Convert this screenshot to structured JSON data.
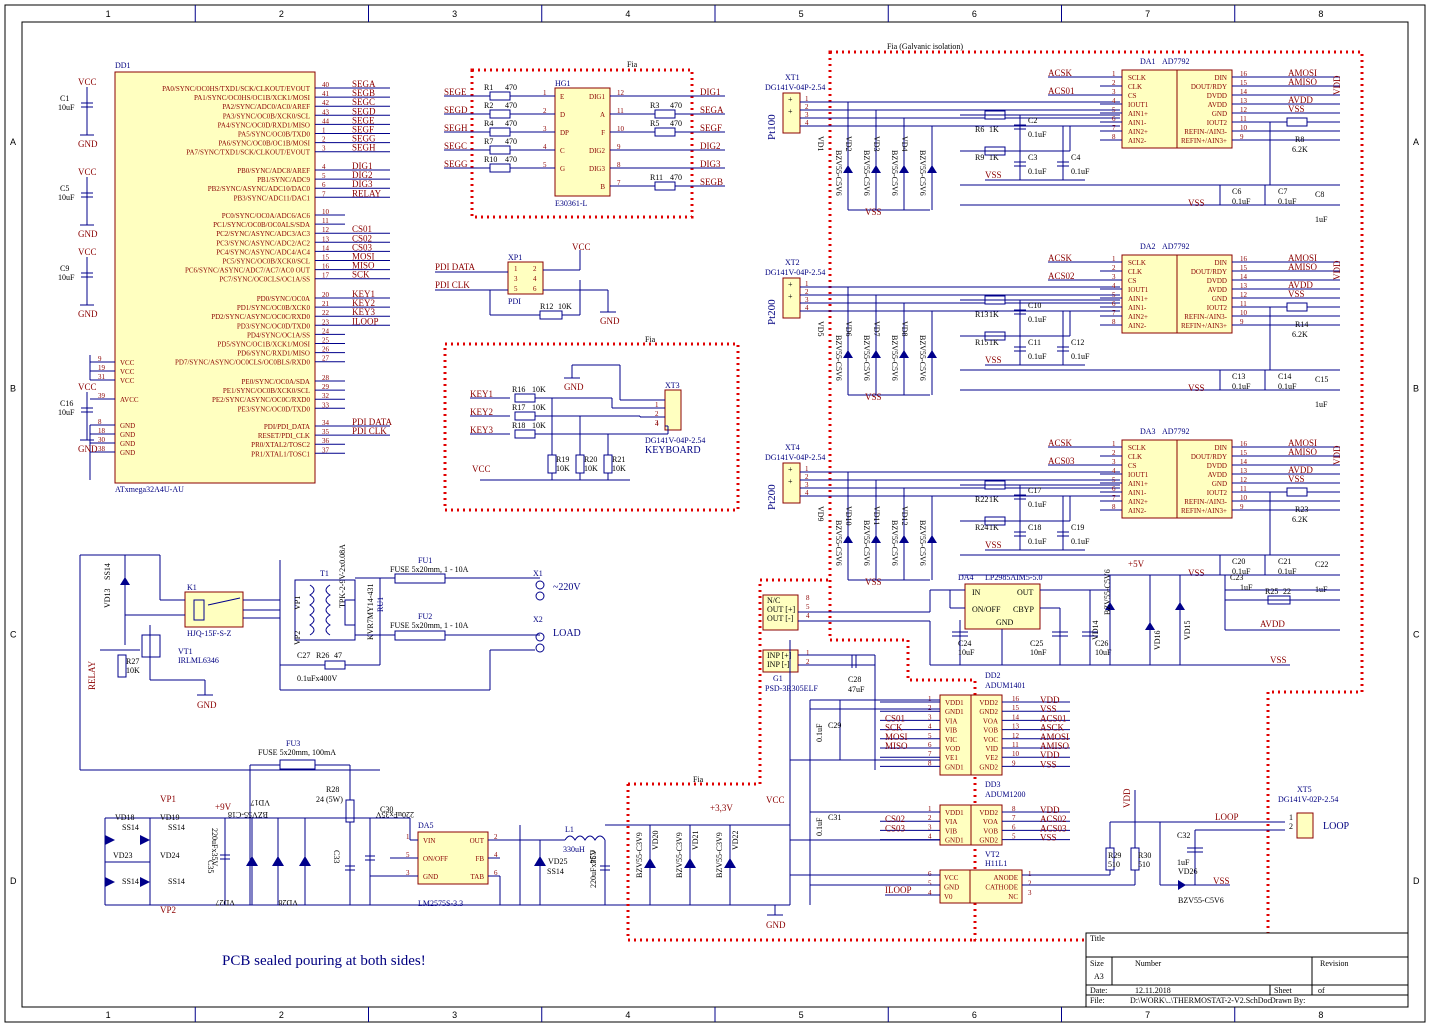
{
  "grid": {
    "cols": [
      "1",
      "2",
      "3",
      "4",
      "5",
      "6",
      "7",
      "8"
    ],
    "rows": [
      "A",
      "B",
      "C",
      "D"
    ]
  },
  "mcu": {
    "ref": "DD1",
    "part": "ATxmega32A4U-AU",
    "left_pins": [
      {
        "num": "9",
        "name": "VCC"
      },
      {
        "num": "19",
        "name": "VCC"
      },
      {
        "num": "31",
        "name": "VCC"
      },
      {
        "num": "39",
        "name": "AVCC"
      },
      {
        "num": "8",
        "name": "GND"
      },
      {
        "num": "18",
        "name": "GND"
      },
      {
        "num": "30",
        "name": "GND"
      },
      {
        "num": "38",
        "name": "GND"
      }
    ],
    "port_a": [
      {
        "name": "PA0/SYNC/OC0HS/TXD1/SCK/CLKOUT/EVOUT",
        "pin": "40",
        "net": "SEGA"
      },
      {
        "name": "PA1/SYNC/OC0HS/OC1B/XCK1/MOSI",
        "pin": "41",
        "net": "SEGB"
      },
      {
        "name": "PA2/SYNC/ADC0/AC0/AREF",
        "pin": "42",
        "net": "SEGC"
      },
      {
        "name": "PA3/SYNC/OC0B/XCK0/SCL",
        "pin": "43",
        "net": "SEGD"
      },
      {
        "name": "PA4/SYNC/OC0D/RXD1/MISO",
        "pin": "44",
        "net": "SEGE"
      },
      {
        "name": "PA5/SYNC/OC0B/TXD0",
        "pin": "1",
        "net": "SEGF"
      },
      {
        "name": "PA6/SYNC/OC0B/OC1B/MOSI",
        "pin": "2",
        "net": "SEGG"
      },
      {
        "name": "PA7/SYNC/TXD1/SCK/CLKOUT/EVOUT",
        "pin": "3",
        "net": "SEGH"
      }
    ],
    "port_b": [
      {
        "name": "PB0/SYNC/ADC8/AREF",
        "pin": "4",
        "net": "DIG1"
      },
      {
        "name": "PB1/SYNC/ADC9",
        "pin": "5",
        "net": "DIG2"
      },
      {
        "name": "PB2/SYNC/ASYNC/ADC10/DAC0",
        "pin": "6",
        "net": "DIG3"
      },
      {
        "name": "PB3/SYNC/ADC11/DAC1",
        "pin": "7",
        "net": "RELAY"
      }
    ],
    "port_c": [
      {
        "name": "PC0/SYNC/OC0A/ADC6/AC6",
        "pin": "10",
        "net": ""
      },
      {
        "name": "PC1/SYNC/OC0B/OC0ALS/SDA",
        "pin": "11",
        "net": ""
      },
      {
        "name": "PC2/SYNC/ASYNC/ADC3/AC3",
        "pin": "12",
        "net": "CS01"
      },
      {
        "name": "PC3/SYNC/ASYNC/ADC2/AC2",
        "pin": "13",
        "net": "CS02"
      },
      {
        "name": "PC4/SYNC/ASYNC/ADC4/AC4",
        "pin": "14",
        "net": "CS03"
      },
      {
        "name": "PC5/SYNC/OC0B/XCK0/SCL",
        "pin": "15",
        "net": "MOSI"
      },
      {
        "name": "PC6/SYNC/ASYNC/ADC7/AC7/AC0 OUT",
        "pin": "16",
        "net": "MISO"
      },
      {
        "name": "PC7/SYNC/OC0CLS/OC1A/SS",
        "pin": "17",
        "net": "SCK"
      }
    ],
    "port_d": [
      {
        "name": "PD0/SYNC/OC0A",
        "pin": "20",
        "net": "KEY1"
      },
      {
        "name": "PD1/SYNC/OC0B/XCK0",
        "pin": "21",
        "net": "KEY2"
      },
      {
        "name": "PD2/SYNC/ASYNC/OC0C/RXD0",
        "pin": "22",
        "net": "KEY3"
      },
      {
        "name": "PD3/SYNC/OC0D/TXD0",
        "pin": "23",
        "net": "ILOOP"
      },
      {
        "name": "PD4/SYNC/OC1A/SS",
        "pin": "24",
        "net": ""
      },
      {
        "name": "PD5/SYNC/OC1B/XCK1/MOSI",
        "pin": "25",
        "net": ""
      },
      {
        "name": "PD6/SYNC/RXD1/MISO",
        "pin": "26",
        "net": ""
      },
      {
        "name": "PD7/SYNC/ASYNC/OC0CLS/OC0BLS/RXD0",
        "pin": "27",
        "net": ""
      }
    ],
    "port_e": [
      {
        "name": "PE0/SYNC/OC0A/SDA",
        "pin": "28",
        "net": ""
      },
      {
        "name": "PE1/SYNC/OC0B/XCK0/SCL",
        "pin": "29",
        "net": ""
      },
      {
        "name": "PE2/SYNC/ASYNC/OC0C/RXD0",
        "pin": "32",
        "net": ""
      },
      {
        "name": "PE3/SYNC/OC0D/TXD0",
        "pin": "33",
        "net": ""
      }
    ],
    "port_misc": [
      {
        "name": "PDI/PDI_DATA",
        "pin": "34",
        "net": "PDI DATA"
      },
      {
        "name": "RESET/PDI_CLK",
        "pin": "35",
        "net": "PDI CLK"
      },
      {
        "name": "PR0/XTAL2/TOSC2",
        "pin": "36",
        "net": ""
      },
      {
        "name": "PR1/XTAL1/TOSC1",
        "pin": "37",
        "net": ""
      }
    ]
  },
  "decoupling": [
    {
      "ref": "C1",
      "value": "10uF",
      "vcc": "VCC",
      "gnd": "GND"
    },
    {
      "ref": "C5",
      "value": "10uF",
      "vcc": "VCC",
      "gnd": "GND"
    },
    {
      "ref": "C9",
      "value": "10uF",
      "vcc": "VCC",
      "gnd": "GND"
    },
    {
      "ref": "C16",
      "value": "10uF",
      "vcc": "VCC",
      "gnd": "GND"
    }
  ],
  "display": {
    "box_title": "Fia",
    "ref": "HG1",
    "part": "E30361-L",
    "left_pins": [
      {
        "net": "SEGE",
        "res": "R1",
        "val": "470",
        "pin": "1",
        "name": "E"
      },
      {
        "net": "SEGD",
        "res": "R2",
        "val": "470",
        "pin": "2",
        "name": "D"
      },
      {
        "net": "SEGH",
        "res": "R4",
        "val": "470",
        "pin": "3",
        "name": "DP"
      },
      {
        "net": "SEGC",
        "res": "R7",
        "val": "470",
        "pin": "4",
        "name": "C"
      },
      {
        "net": "SEGG",
        "res": "R10",
        "val": "470",
        "pin": "5",
        "name": "G"
      }
    ],
    "right_pins": [
      {
        "net": "DIG1",
        "res": "",
        "val": "",
        "pin": "12",
        "name": "DIG1"
      },
      {
        "net": "SEGA",
        "res": "R3",
        "val": "470",
        "pin": "11",
        "name": "A"
      },
      {
        "net": "SEGF",
        "res": "R5",
        "val": "470",
        "pin": "10",
        "name": "F"
      },
      {
        "net": "DIG2",
        "res": "",
        "val": "",
        "pin": "9",
        "name": "DIG2"
      },
      {
        "net": "DIG3",
        "res": "",
        "val": "",
        "pin": "8",
        "name": "DIG3"
      },
      {
        "net": "SEGB",
        "res": "R11",
        "val": "470",
        "pin": "7",
        "name": "B"
      }
    ]
  },
  "pdi": {
    "ref": "XP1",
    "part": "PDI",
    "data": "PDI DATA",
    "clk": "PDI CLK",
    "pins": [
      "1",
      "2",
      "3",
      "4",
      "5",
      "6"
    ],
    "res": "R12",
    "res_val": "10K",
    "vcc": "VCC",
    "gnd": "GND"
  },
  "keyboard": {
    "box_title": "Fia",
    "ref": "XT3",
    "part": "DG141V-04P-2.54",
    "name": "KEYBOARD",
    "gnd": "GND",
    "vcc": "VCC",
    "keys": [
      {
        "net": "KEY1",
        "res": "R16",
        "val": "10K",
        "pull": "R19",
        "pull_val": "10K",
        "pin": "1"
      },
      {
        "net": "KEY2",
        "res": "R17",
        "val": "10K",
        "pull": "R20",
        "pull_val": "10K",
        "pin": "2"
      },
      {
        "net": "KEY3",
        "res": "R18",
        "val": "10K",
        "pull": "R21",
        "pull_val": "10K",
        "pin": "3"
      }
    ],
    "pin4": "4"
  },
  "isolation": {
    "title": "Fia (Galvanic isolation)",
    "channels": [
      {
        "conn": "XT1",
        "conn_part": "DG141V-04P-2.54",
        "sensor": "Pt100",
        "adc": "DA1",
        "adc_part": "AD7792",
        "diodes": [
          "VD1",
          "VD2",
          "VD3",
          "VD4"
        ],
        "res_a": "R6",
        "res_a_val": "1K",
        "res_b": "R9",
        "res_b_val": "1K",
        "caps": [
          "C2",
          "C3",
          "C4"
        ],
        "cap_val": "0.1uF",
        "cs": "ACS01",
        "rref": "R8",
        "rref_val": "6.2K",
        "c_a": "C6",
        "c_b": "C7",
        "c_c": "C8",
        "c_c_val": "1uF"
      },
      {
        "conn": "XT2",
        "conn_part": "DG141V-04P-2.54",
        "sensor": "Pt200",
        "adc": "DA2",
        "adc_part": "AD7792",
        "diodes": [
          "VD5",
          "VD6",
          "VD7",
          "VD8"
        ],
        "res_a": "R13",
        "res_a_val": "1K",
        "res_b": "R15",
        "res_b_val": "1K",
        "caps": [
          "C10",
          "C11",
          "C12"
        ],
        "cap_val": "0.1uF",
        "cs": "ACS02",
        "rref": "R14",
        "rref_val": "6.2K",
        "c_a": "C13",
        "c_b": "C14",
        "c_c": "C15",
        "c_c_val": "1uF"
      },
      {
        "conn": "XT4",
        "conn_part": "DG141V-04P-2.54",
        "sensor": "Pt200",
        "adc": "DA3",
        "adc_part": "AD7792",
        "diodes": [
          "VD9",
          "VD10",
          "VD11",
          "VD12"
        ],
        "res_a": "R22",
        "res_a_val": "1K",
        "res_b": "R24",
        "res_b_val": "1K",
        "caps": [
          "C17",
          "C18",
          "C19"
        ],
        "cap_val": "0.1uF",
        "cs": "ACS03",
        "rref": "R23",
        "rref_val": "6.2K",
        "c_a": "C20",
        "c_b": "C21",
        "c_c": "C22",
        "c_c_val": "1uF"
      }
    ],
    "diode_part": "BZV55-C5V6",
    "vss": "VSS",
    "adc_left": [
      {
        "name": "SCLK",
        "pin": "1"
      },
      {
        "name": "CLK",
        "pin": "2"
      },
      {
        "name": "CS",
        "pin": "3"
      },
      {
        "name": "IOUT1",
        "pin": "4"
      },
      {
        "name": "AIN1+",
        "pin": "5"
      },
      {
        "name": "AIN1-",
        "pin": "6"
      },
      {
        "name": "AIN2+",
        "pin": "7"
      },
      {
        "name": "AIN2-",
        "pin": "8"
      }
    ],
    "adc_right": [
      {
        "name": "DIN",
        "pin": "16",
        "net": "AMOSI"
      },
      {
        "name": "DOUT/RDY",
        "pin": "15",
        "net": "AMISO"
      },
      {
        "name": "DVDD",
        "pin": "14",
        "net": ""
      },
      {
        "name": "AVDD",
        "pin": "13",
        "net": "AVDD"
      },
      {
        "name": "GND",
        "pin": "12",
        "net": "VSS"
      },
      {
        "name": "IOUT2",
        "pin": "11",
        "net": ""
      },
      {
        "name": "REFIN-/AIN3-",
        "pin": "10",
        "net": ""
      },
      {
        "name": "REFIN+/AIN3+",
        "pin": "9",
        "net": ""
      }
    ],
    "ack": "ACSK",
    "vdd": "VDD"
  },
  "ldo": {
    "ref": "DA4",
    "part": "LP2985AIM5-5.0",
    "pins": [
      {
        "num": "1",
        "name": "IN"
      },
      {
        "num": "3",
        "name": "ON/OFF"
      },
      {
        "num": "2",
        "name": "GND"
      },
      {
        "num": "5",
        "name": "OUT"
      },
      {
        "num": "4",
        "name": "CBYP"
      }
    ],
    "c24": "C24",
    "c24_val": "10uF",
    "c25": "C25",
    "c25_val": "10nF",
    "c26": "C26",
    "c26_val": "10uF",
    "c23": "C23",
    "c23_val": "1uF",
    "r25": "R25",
    "r25_val": "22",
    "plus5": "+5V",
    "d14": "VD14",
    "d15": "VD15",
    "d16": "VD16",
    "d_part": "BZV55-C5V6",
    "avdd": "AVDD",
    "vss": "VSS"
  },
  "isolated_psu": {
    "ref": "G1",
    "part": "PSD-3R305ELF",
    "pins": [
      {
        "num": "8",
        "name": "N/C"
      },
      {
        "num": "5",
        "name": "OUT [+]"
      },
      {
        "num": "4",
        "name": "OUT [-]"
      },
      {
        "num": "1",
        "name": "INP [+]"
      },
      {
        "num": "2",
        "name": "INP [-]"
      }
    ],
    "c28": "C28",
    "c28_val": "47uF"
  },
  "adum1401": {
    "ref": "DD2",
    "part": "ADUM1401",
    "c29": "C29",
    "c29_val": "0.1uF",
    "left": [
      {
        "pin": "1",
        "name": "VDD1",
        "net": ""
      },
      {
        "pin": "2",
        "name": "GND1",
        "net": ""
      },
      {
        "pin": "3",
        "name": "VIA",
        "net": "CS01"
      },
      {
        "pin": "4",
        "name": "VIB",
        "net": "SCK"
      },
      {
        "pin": "5",
        "name": "VIC",
        "net": "MOSI"
      },
      {
        "pin": "6",
        "name": "VOD",
        "net": "MISO"
      },
      {
        "pin": "7",
        "name": "VE1",
        "net": ""
      },
      {
        "pin": "8",
        "name": "GND1",
        "net": ""
      }
    ],
    "right": [
      {
        "pin": "16",
        "name": "VDD2",
        "net": "VDD"
      },
      {
        "pin": "15",
        "name": "GND2",
        "net": "VSS"
      },
      {
        "pin": "14",
        "name": "VOA",
        "net": "ACS01"
      },
      {
        "pin": "13",
        "name": "VOB",
        "net": "ASCK"
      },
      {
        "pin": "12",
        "name": "VOC",
        "net": "AMOSI"
      },
      {
        "pin": "11",
        "name": "VID",
        "net": "AMISO"
      },
      {
        "pin": "10",
        "name": "VE2",
        "net": "VDD"
      },
      {
        "pin": "9",
        "name": "GND2",
        "net": "VSS"
      }
    ]
  },
  "adum1200": {
    "ref": "DD3",
    "part": "ADUM1200",
    "c31": "C31",
    "c31_val": "0.1uF",
    "left": [
      {
        "pin": "1",
        "name": "VDD1",
        "net": ""
      },
      {
        "pin": "2",
        "name": "VIA",
        "net": "CS02"
      },
      {
        "pin": "3",
        "name": "VIB",
        "net": "CS03"
      },
      {
        "pin": "4",
        "name": "GND1",
        "net": ""
      }
    ],
    "right": [
      {
        "pin": "8",
        "name": "VDD2",
        "net": "VDD"
      },
      {
        "pin": "7",
        "name": "VOA",
        "net": "ACS02"
      },
      {
        "pin": "6",
        "name": "VOB",
        "net": "ACS03"
      },
      {
        "pin": "5",
        "name": "GND2",
        "net": "VSS"
      }
    ]
  },
  "optocoupler": {
    "ref": "VT2",
    "part": "H11L1",
    "left": [
      {
        "pin": "6",
        "name": "VCC"
      },
      {
        "pin": "5",
        "name": "GND"
      },
      {
        "pin": "4",
        "name": "V0"
      }
    ],
    "right": [
      {
        "pin": "1",
        "name": "ANODE"
      },
      {
        "pin": "2",
        "name": "CATHODE"
      },
      {
        "pin": "3",
        "name": "NC"
      }
    ],
    "iloop": "ILOOP",
    "r29": "R29",
    "r29_val": "510",
    "r30": "R30",
    "r30_val": "510",
    "c32": "C32",
    "c32_val": "1uF",
    "d26": "VD26",
    "d26_part": "BZV55-C5V6",
    "vdd": "VDD",
    "vss": "VSS",
    "loop": "LOOP",
    "conn": "XT5",
    "conn_part": "DG141V-02P-2.54",
    "conn_name": "LOOP"
  },
  "relay": {
    "ref": "K1",
    "part": "HJQ-15F-S-Z",
    "diode": "VD13",
    "diode_part": "SS14",
    "fet": "VT1",
    "fet_part": "IRLML6346",
    "r27": "R27",
    "r27_val": "10K",
    "relay_net": "RELAY",
    "gnd": "GND",
    "pins": [
      "3",
      "4",
      "1",
      "2",
      "5"
    ]
  },
  "mains": {
    "transformer": "T1",
    "tr_part": "TPK-2-9V-2x0.08A",
    "vp1": "VP1",
    "vp2": "VP2",
    "varistor": "RU1",
    "var_part": "KVR7MY14-431",
    "fu1": "FU1",
    "fu1_part": "FUSE 5x20mm, 1 - 10A",
    "fu2": "FU2",
    "fu2_part": "FUSE 5x20mm, 1 - 10A",
    "x1": "X1",
    "x1_name": "~220V",
    "x2": "X2",
    "x2_name": "LOAD",
    "c27": "C27",
    "c27_val": "0.1uFx400V",
    "r26": "R26",
    "r26_val": "47",
    "tr_pins": [
      "9",
      "7",
      "1",
      "2",
      "3",
      "4",
      "5"
    ]
  },
  "main_psu": {
    "fu3": "FU3",
    "fu3_part": "FUSE 5x20mm, 100mA",
    "r28": "R28",
    "r28_val": "24 (5W)",
    "c30": "C30",
    "c30_val": "220uFx35V",
    "c33": "C33",
    "c33_val": "0.1uF",
    "c35": "C35",
    "c35_val": "220uFx35V",
    "vd17": "VD17",
    "vd18": "VD18",
    "vd19": "VD19",
    "vd23": "VD23",
    "vd24": "VD24",
    "vd25": "VD25",
    "vd27": "VD27",
    "vd28": "VD28",
    "bridge_part": "SS14",
    "zener_part": "BZV55-C18",
    "plus9": "+9V",
    "vp1": "VP1",
    "vp2": "VP2",
    "reg": "DA5",
    "reg_part": "LM2575S-3.3",
    "reg_pins": [
      {
        "pin": "1",
        "name": "VIN"
      },
      {
        "pin": "5",
        "name": "ON/OFF"
      },
      {
        "pin": "3",
        "name": "GND"
      },
      {
        "pin": "2",
        "name": "OUT"
      },
      {
        "pin": "4",
        "name": "FB"
      },
      {
        "pin": "6",
        "name": "TAB"
      }
    ],
    "l1": "L1",
    "l1_val": "330uH",
    "c34": "C34",
    "c34_val": "220uFx35V",
    "vd25_part": "SS14"
  },
  "out_stage": {
    "box_title": "Fia",
    "plus33": "+3,3V",
    "vcc": "VCC",
    "gnd": "GND",
    "diodes": [
      "VD20",
      "VD21",
      "VD22"
    ],
    "diode_part": "BZV55-C3V9"
  },
  "note": "PCB sealed pouring at both sides!",
  "title_block": {
    "title_label": "Title",
    "size_label": "Size",
    "size": "A3",
    "number_label": "Number",
    "revision_label": "Revision",
    "date_label": "Date:",
    "date": "12.11.2018",
    "sheet_label": "Sheet",
    "of_label": "of",
    "file_label": "File:",
    "file": "D:\\WORK\\..\\THERMOSTAT-2-V2.SchDoc",
    "drawn_label": "Drawn By:"
  }
}
